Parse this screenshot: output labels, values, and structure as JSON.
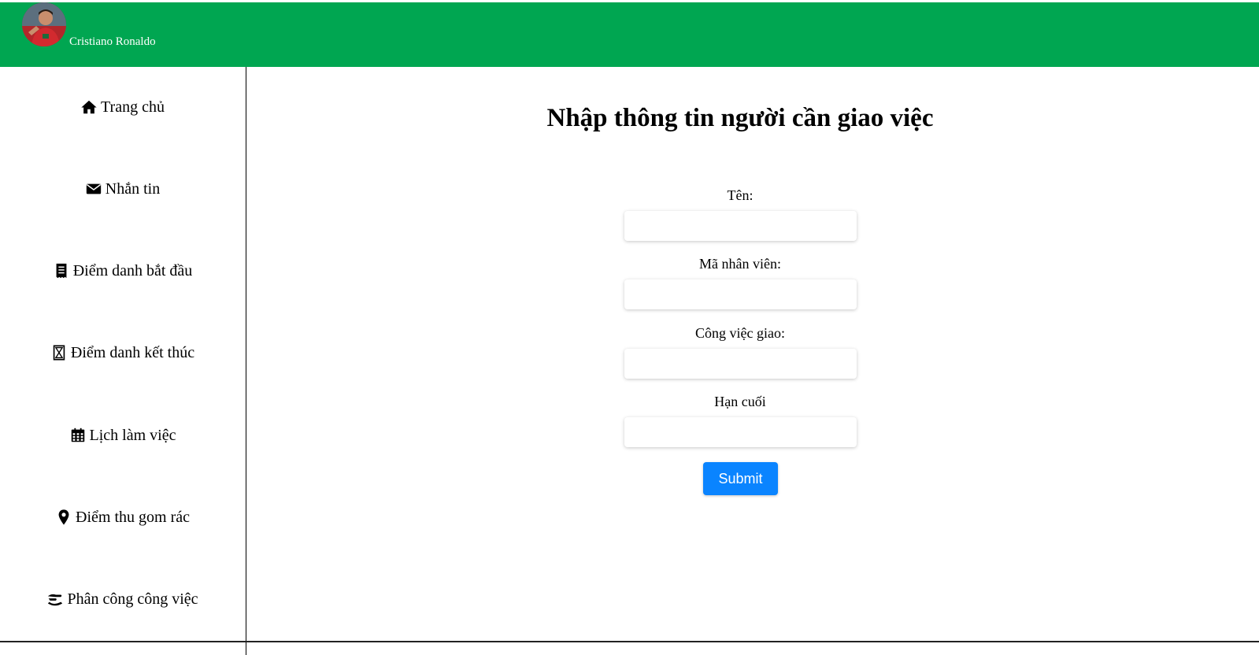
{
  "header": {
    "username": "Cristiano Ronaldo",
    "brand_color": "#00a651"
  },
  "sidebar": {
    "items": [
      {
        "label": "Trang chủ",
        "icon": "home-icon"
      },
      {
        "label": "Nhắn tin",
        "icon": "envelope-icon"
      },
      {
        "label": "Điểm danh bắt đầu",
        "icon": "receipt-icon"
      },
      {
        "label": "Điểm danh kết thúc",
        "icon": "hourglass-icon"
      },
      {
        "label": "Lịch làm việc",
        "icon": "calendar-icon"
      },
      {
        "label": "Điểm thu gom rác",
        "icon": "location-pin-icon"
      },
      {
        "label": "Phân công công việc",
        "icon": "handshake-icon"
      }
    ]
  },
  "form": {
    "title": "Nhập thông tin người cần giao việc",
    "fields": [
      {
        "label": "Tên:",
        "value": ""
      },
      {
        "label": "Mã nhân viên:",
        "value": ""
      },
      {
        "label": "Công việc giao:",
        "value": ""
      },
      {
        "label": "Hạn cuối",
        "value": ""
      }
    ],
    "submit_label": "Submit",
    "submit_color": "#0a84ff"
  }
}
